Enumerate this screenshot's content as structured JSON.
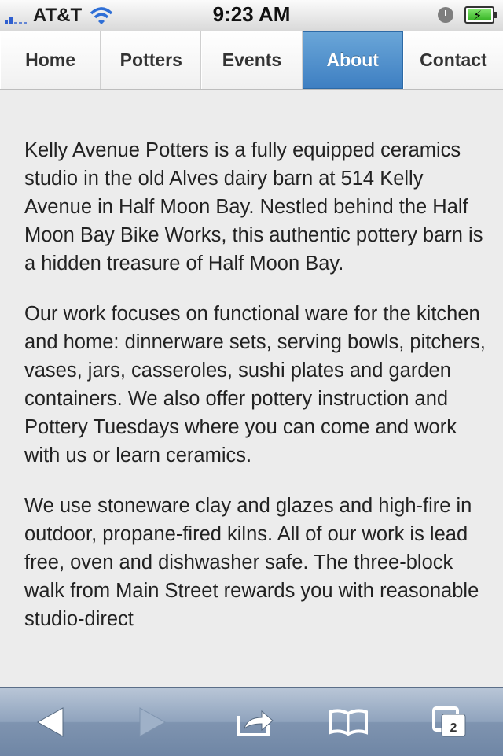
{
  "status_bar": {
    "carrier": "AT&T",
    "time": "9:23 AM",
    "battery_color": "#3fbf2a"
  },
  "nav": {
    "tabs": [
      {
        "label": "Home",
        "active": false
      },
      {
        "label": "Potters",
        "active": false
      },
      {
        "label": "Events",
        "active": false
      },
      {
        "label": "About",
        "active": true
      },
      {
        "label": "Contact",
        "active": false
      }
    ]
  },
  "content": {
    "paragraphs": [
      "Kelly Avenue Potters is a fully equipped ceramics studio in the old Alves dairy barn at 514 Kelly Avenue in Half Moon Bay. Nestled behind the Half Moon Bay Bike Works, this authentic pottery barn is a hidden treasure of Half Moon Bay.",
      "Our work focuses on functional ware for the kitchen and home: dinnerware sets, serving bowls, pitchers, vases, jars, casseroles, sushi plates and garden containers. We also offer pottery instruction and Pottery Tuesdays where you can come and work with us or learn ceramics.",
      "We use stoneware clay and glazes and high-fire in outdoor, propane-fired kilns. All of our work is lead free, oven and dishwasher safe. The three-block walk from Main Street rewards you with reasonable studio-direct"
    ]
  },
  "toolbar": {
    "back_icon": "back-arrow-icon",
    "forward_icon": "forward-arrow-icon",
    "share_icon": "share-icon",
    "bookmarks_icon": "bookmarks-icon",
    "pages_icon": "pages-icon",
    "pages_count": "2"
  },
  "colors": {
    "active_tab": "#4a8ccb",
    "toolbar": "#8fa3bd",
    "page_background": "#ececec"
  }
}
